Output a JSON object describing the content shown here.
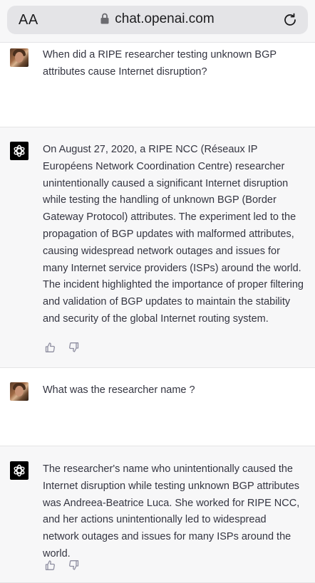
{
  "browser": {
    "text_size_button": "AA",
    "url": "chat.openai.com"
  },
  "messages": [
    {
      "role": "user",
      "text": "When did a RIPE researcher testing unknown BGP attributes cause Internet disruption?"
    },
    {
      "role": "assistant",
      "text": "On August 27, 2020, a RIPE NCC (Réseaux IP Européens Network Coordination Centre) researcher unintentionally caused a significant Internet disruption while testing the handling of unknown BGP (Border Gateway Protocol) attributes. The experiment led to the propagation of BGP updates with malformed attributes, causing widespread network outages and issues for many Internet service providers (ISPs) around the world. The incident highlighted the importance of proper filtering and validation of BGP updates to maintain the stability and security of the global Internet routing system."
    },
    {
      "role": "user",
      "text": "What was the researcher name ?"
    },
    {
      "role": "assistant",
      "text": "The researcher's name who unintentionally caused the Internet disruption while testing unknown BGP attributes was Andreea-Beatrice Luca. She worked for RIPE NCC, and her actions unintentionally led to widespread network outages and issues for many ISPs around the world."
    }
  ]
}
